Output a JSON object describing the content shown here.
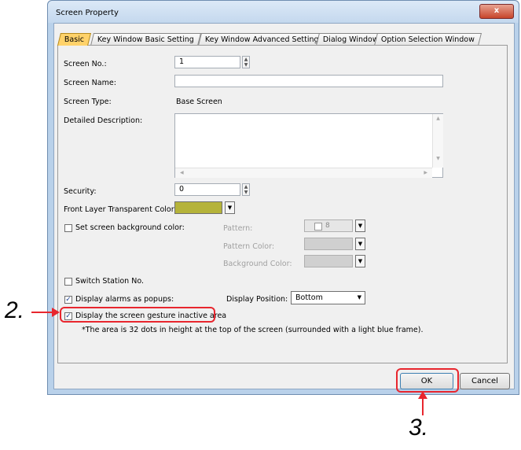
{
  "window": {
    "title": "Screen Property",
    "close_glyph": "x"
  },
  "tabs": [
    {
      "label": "Basic",
      "active": true
    },
    {
      "label": "Key Window Basic Setting"
    },
    {
      "label": "Key Window Advanced Setting"
    },
    {
      "label": "Dialog Window"
    },
    {
      "label": "Option Selection Window"
    }
  ],
  "fields": {
    "screen_no": {
      "label": "Screen No.:",
      "value": "1"
    },
    "screen_name": {
      "label": "Screen Name:",
      "value": ""
    },
    "screen_type": {
      "label": "Screen Type:",
      "value": "Base Screen"
    },
    "detailed_description": {
      "label": "Detailed Description:",
      "value": ""
    },
    "security": {
      "label": "Security:",
      "value": "0"
    },
    "front_layer_color": {
      "label": "Front Layer Transparent Color:",
      "color": "#b5b33a"
    },
    "set_bg_color": {
      "label": "Set screen background color:",
      "checked": false
    },
    "pattern": {
      "label": "Pattern:",
      "value": "8"
    },
    "pattern_color": {
      "label": "Pattern Color:"
    },
    "background_color": {
      "label": "Background Color:"
    },
    "switch_station": {
      "label": "Switch Station No.",
      "checked": false
    },
    "display_alarms": {
      "label": "Display alarms as popups:",
      "checked": true
    },
    "display_position": {
      "label": "Display Position:",
      "value": "Bottom"
    },
    "gesture_inactive": {
      "label": "Display the screen gesture inactive area",
      "checked": true
    },
    "note": "*The area is 32 dots in height at the top of the screen (surrounded with a light blue frame)."
  },
  "buttons": {
    "ok": "OK",
    "cancel": "Cancel"
  },
  "annotations": {
    "step2": "2.",
    "step3": "3."
  },
  "colors": {
    "highlight": "#e8262e",
    "active_tab": "#ffd26a"
  }
}
